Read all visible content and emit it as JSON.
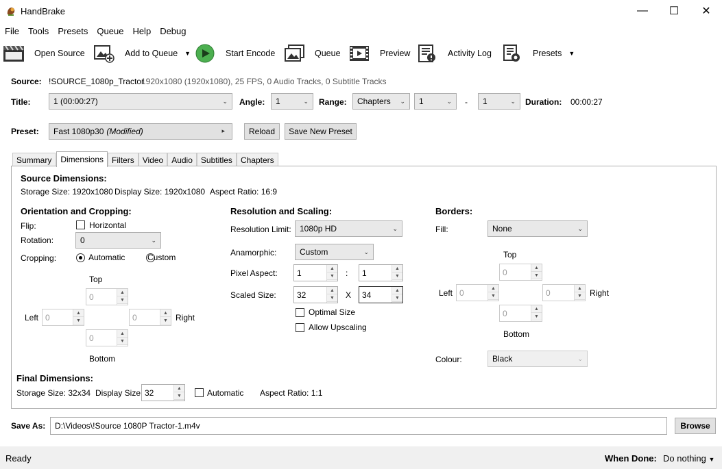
{
  "window": {
    "title": "HandBrake",
    "minimize": "—",
    "maximize": "☐",
    "close": "✕"
  },
  "menu": [
    "File",
    "Tools",
    "Presets",
    "Queue",
    "Help",
    "Debug"
  ],
  "toolbar": {
    "open_source": "Open Source",
    "add_to_queue": "Add to Queue",
    "start_encode": "Start Encode",
    "queue": "Queue",
    "preview": "Preview",
    "activity_log": "Activity Log",
    "presets": "Presets"
  },
  "source": {
    "label": "Source:",
    "name": "!SOURCE_1080p_Tractor",
    "info": "1920x1080 (1920x1080), 25 FPS, 0 Audio Tracks, 0 Subtitle Tracks"
  },
  "title_row": {
    "title_label": "Title:",
    "title_value": "1  (00:00:27)",
    "angle_label": "Angle:",
    "angle_value": "1",
    "range_label": "Range:",
    "range_type": "Chapters",
    "range_start": "1",
    "range_sep": "-",
    "range_end": "1",
    "duration_label": "Duration:",
    "duration_value": "00:00:27"
  },
  "preset": {
    "label": "Preset:",
    "name": "Fast 1080p30",
    "modified": "(Modified)",
    "reload": "Reload",
    "save_new": "Save New Preset"
  },
  "tabs": [
    "Summary",
    "Dimensions",
    "Filters",
    "Video",
    "Audio",
    "Subtitles",
    "Chapters"
  ],
  "dimensions": {
    "source_heading": "Source Dimensions:",
    "storage_size": "Storage Size: 1920x1080",
    "display_size": "Display Size: 1920x1080",
    "aspect_ratio": "Aspect Ratio: 16:9",
    "orientation": {
      "heading": "Orientation and Cropping:",
      "flip_label": "Flip:",
      "flip_option": "Horizontal",
      "rotation_label": "Rotation:",
      "rotation_value": "0",
      "cropping_label": "Cropping:",
      "crop_auto": "Automatic",
      "crop_custom": "Custom",
      "top": "Top",
      "bottom": "Bottom",
      "left": "Left",
      "right": "Right",
      "top_value": "0",
      "bottom_value": "0",
      "left_value": "0",
      "right_value": "0"
    },
    "resolution": {
      "heading": "Resolution and Scaling:",
      "limit_label": "Resolution Limit:",
      "limit_value": "1080p HD",
      "anamorphic_label": "Anamorphic:",
      "anamorphic_value": "Custom",
      "pixel_aspect_label": "Pixel Aspect:",
      "par_x": "1",
      "par_sep": ":",
      "par_y": "1",
      "scaled_label": "Scaled Size:",
      "width": "32",
      "size_sep": "X",
      "height": "34",
      "optimal": "Optimal Size",
      "upscaling": "Allow Upscaling"
    },
    "borders": {
      "heading": "Borders:",
      "fill_label": "Fill:",
      "fill_value": "None",
      "top": "Top",
      "bottom": "Bottom",
      "left": "Left",
      "right": "Right",
      "top_value": "0",
      "bottom_value": "0",
      "left_value": "0",
      "right_value": "0",
      "colour_label": "Colour:",
      "colour_value": "Black"
    },
    "final": {
      "heading": "Final Dimensions:",
      "storage": "Storage Size: 32x34",
      "display_label": "Display Size:",
      "display_value": "32",
      "automatic": "Automatic",
      "aspect": "Aspect Ratio: 1:1"
    }
  },
  "save_as": {
    "label": "Save As:",
    "path": "D:\\Videos\\!Source 1080P Tractor-1.m4v",
    "browse": "Browse"
  },
  "status": {
    "text": "Ready",
    "when_done_label": "When Done:",
    "when_done_value": "Do nothing"
  }
}
